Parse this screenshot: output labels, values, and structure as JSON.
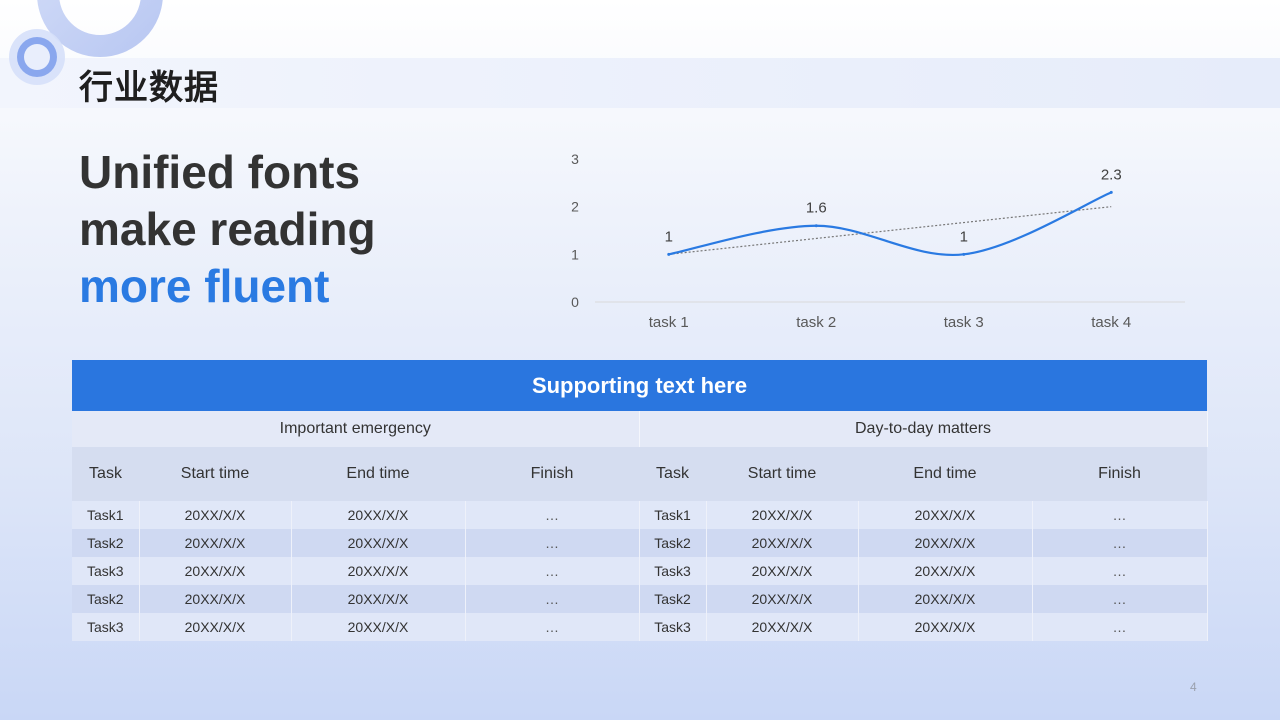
{
  "slide": {
    "title": "行业数据",
    "headline_line1": "Unified fonts",
    "headline_line2": "make reading",
    "headline_line3": "more fluent",
    "page_number": "4"
  },
  "chart_data": {
    "type": "line",
    "categories": [
      "task 1",
      "task 2",
      "task 3",
      "task 4"
    ],
    "series": [
      {
        "values": [
          1,
          1.6,
          1,
          2.3
        ],
        "color": "#2a7ae2",
        "smooth": true,
        "data_labels": true
      }
    ],
    "trendline": {
      "style": "dotted",
      "color": "#777777",
      "values": [
        1.0,
        1.33,
        1.67,
        2.0
      ]
    },
    "yticks": [
      "0",
      "1",
      "2",
      "3"
    ],
    "ylim": [
      0,
      3
    ],
    "grid": false,
    "title": "",
    "xlabel": "",
    "ylabel": ""
  },
  "table": {
    "banner": "Supporting text here",
    "groups": [
      "Important emergency",
      "Day-to-day matters"
    ],
    "columns": [
      "Task",
      "Start time",
      "End time",
      "Finish",
      "Task",
      "Start time",
      "End time",
      "Finish"
    ],
    "rows": [
      [
        "Task1",
        "20XX/X/X",
        "20XX/X/X",
        "…",
        "Task1",
        "20XX/X/X",
        "20XX/X/X",
        "…"
      ],
      [
        "Task2",
        "20XX/X/X",
        "20XX/X/X",
        "…",
        "Task2",
        "20XX/X/X",
        "20XX/X/X",
        "…"
      ],
      [
        "Task3",
        "20XX/X/X",
        "20XX/X/X",
        "…",
        "Task3",
        "20XX/X/X",
        "20XX/X/X",
        "…"
      ],
      [
        "Task2",
        "20XX/X/X",
        "20XX/X/X",
        "…",
        "Task2",
        "20XX/X/X",
        "20XX/X/X",
        "…"
      ],
      [
        "Task3",
        "20XX/X/X",
        "20XX/X/X",
        "…",
        "Task3",
        "20XX/X/X",
        "20XX/X/X",
        "…"
      ]
    ]
  },
  "colors": {
    "accent": "#2a7ae2",
    "banner": "#2a76df",
    "text": "#333333"
  }
}
